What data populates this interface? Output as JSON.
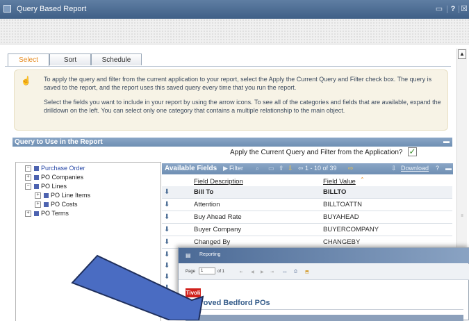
{
  "window": {
    "title": "Query Based Report",
    "controls": [
      "▭",
      "?",
      "☒"
    ]
  },
  "tabs": [
    {
      "label": "Select",
      "active": true
    },
    {
      "label": "Sort",
      "active": false
    },
    {
      "label": "Schedule",
      "active": false
    }
  ],
  "info": {
    "paragraph1": "To apply the query and filter from the current application to your report, select the Apply the Current Query and Filter check box. The query is saved to the report, and the report uses this saved query every time that you run the report.",
    "paragraph2": "Select the fields you want to include in your report by using the arrow icons. To see all of the categories and fields that are available, expand the drilldown on the left. You can select only one category that contains a multiple relationship to the main object."
  },
  "query_section": {
    "title": "Query to Use in the Report",
    "apply_label": "Apply the Current Query and Filter from the Application?",
    "apply_checked": true
  },
  "tree": [
    {
      "label": "Purchase Order",
      "expander": "−",
      "link": true
    },
    {
      "label": "PO Companies",
      "expander": "+"
    },
    {
      "label": "PO Lines",
      "expander": "−"
    },
    {
      "label": "PO Line Items",
      "expander": "+"
    },
    {
      "label": "PO Costs",
      "expander": "+"
    },
    {
      "label": "PO Terms",
      "expander": "+"
    }
  ],
  "fields_panel": {
    "title": "Available Fields",
    "filter_label": "Filter",
    "range": "1 - 10 of 39",
    "download_label": "Download",
    "help": "?",
    "col_desc": "Field Description",
    "col_val": "Field Value",
    "rows": [
      {
        "desc": "Bill To",
        "val": "BILLTO"
      },
      {
        "desc": "Attention",
        "val": "BILLTOATTN"
      },
      {
        "desc": "Buy Ahead Rate",
        "val": "BUYAHEAD"
      },
      {
        "desc": "Buyer Company",
        "val": "BUYERCOMPANY"
      },
      {
        "desc": "Changed By",
        "val": "CHANGEBY"
      }
    ]
  },
  "report_window": {
    "title": "Reporting",
    "page_label": "Page",
    "page_value": "1",
    "of_label": "of 1",
    "brand": "Tivoli",
    "heading": "Approved Bedford POs"
  },
  "colors": {
    "accent": "#6f8fb3",
    "active_tab": "#e58a1f",
    "arrow": "#4a6cc2"
  }
}
